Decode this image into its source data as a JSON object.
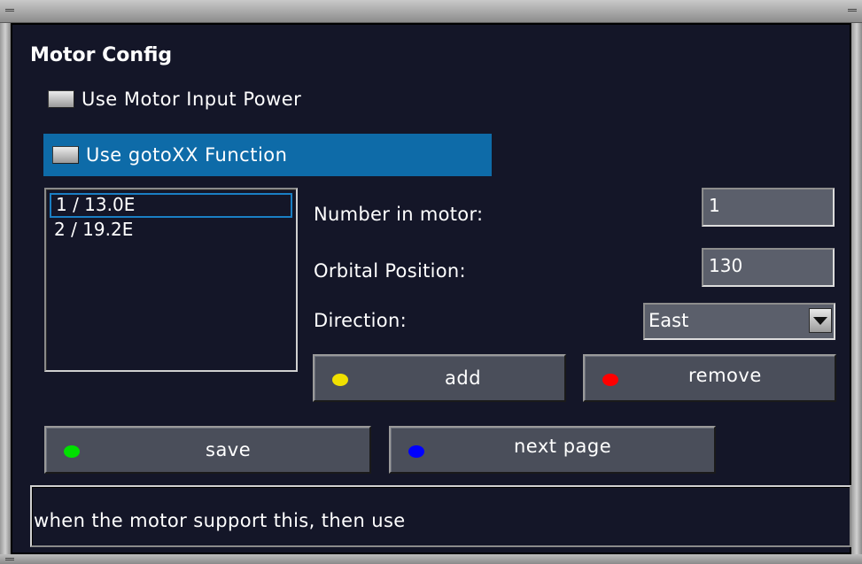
{
  "screen": {
    "title": "Motor Config"
  },
  "options": {
    "use_motor_input_power": {
      "label": "Use Motor Input Power",
      "checked": false
    },
    "use_gotoxx_function": {
      "label": "Use gotoXX Function",
      "checked": false,
      "focused": true
    }
  },
  "satellite_list": {
    "items": [
      "1 / 13.0E",
      "2 / 19.2E"
    ],
    "selected_index": 0
  },
  "fields": {
    "number_in_motor": {
      "label": "Number in motor:",
      "value": "1"
    },
    "orbital_position": {
      "label": "Orbital Position:",
      "value": "130"
    },
    "direction": {
      "label": "Direction:",
      "value": "East"
    }
  },
  "buttons": {
    "add": {
      "label": "add",
      "color": "#f0e000"
    },
    "remove": {
      "label": "remove",
      "color": "#ff0000"
    },
    "save": {
      "label": "save",
      "color": "#00e000"
    },
    "next_page": {
      "label": "next page",
      "color": "#0000ff"
    }
  },
  "status": {
    "text": "when the motor support this, then use"
  },
  "colors": {
    "background": "#141628",
    "highlight": "#0e6ba8",
    "field": "#5b5f6b",
    "button": "#4a4e5a"
  }
}
